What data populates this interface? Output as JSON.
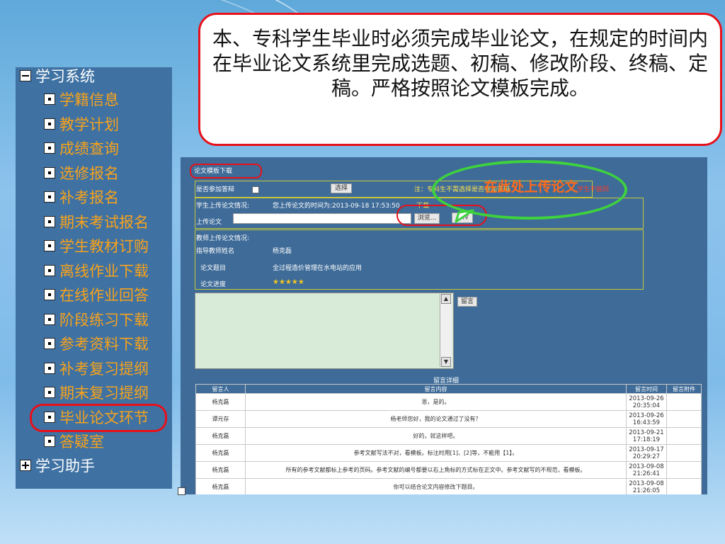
{
  "callout": {
    "text": "本、专科学生毕业时必须完成毕业论文，在规定的时间内在毕业论文系统里完成选题、初稿、修改阶段、终稿、定稿。严格按照论文模板完成。"
  },
  "sidebar": {
    "root": "学习系统",
    "items": [
      "学籍信息",
      "教学计划",
      "成绩查询",
      "选修报名",
      "补考报名",
      "期末考试报名",
      "学生教材订购",
      "离线作业下载",
      "在线作业回答",
      "阶段练习下载",
      "参考资料下载",
      "补考复习提纲",
      "期末复习提纲",
      "毕业论文环节",
      "答疑室"
    ],
    "root2": "学习助手"
  },
  "panel": {
    "template_link": "论文模板下载",
    "participate_label": "是否参加答辩",
    "select_button": "选择",
    "note": "注：专科生不需选择是否参加答辩",
    "note_tail": "学生不能同",
    "student_upload_label": "学生上传论文情况:",
    "upload_time": "您上传论文的时间为:2013-09-18  17:53:50",
    "upload_time_tail": "下载",
    "upload_label": "上传论文",
    "browse_button": "浏览...",
    "upload_button": "上传",
    "teacher_upload_label": "教师上传论文情况:",
    "advisor_label": "指导教师姓名",
    "advisor_name": "杨克磊",
    "topic_label": "论文题目",
    "topic": "全过程造价管理在水电站的应用",
    "progress_label": "论文进度",
    "progress_stars": 5,
    "message_button": "留言",
    "detail_title": "留言详细"
  },
  "messages": {
    "columns": [
      "留言人",
      "留言内容",
      "留言时间",
      "留言附件"
    ],
    "rows": [
      {
        "author": "杨克磊",
        "content": "恩，是的。",
        "date": "2013-09-26",
        "time": "20:35:04"
      },
      {
        "author": "谭元存",
        "content": "杨老师您好，我的论文通过了没有？",
        "date": "2013-09-26",
        "time": "16:43:59"
      },
      {
        "author": "杨克磊",
        "content": "好的，就这样吧。",
        "date": "2013-09-21",
        "time": "17:18:19"
      },
      {
        "author": "杨克磊",
        "content": "参考文献写法不对，看模板。标注时用[1]、[2]等，不能用【1】。",
        "date": "2013-09-17",
        "time": "20:29:27"
      },
      {
        "author": "杨克磊",
        "content": "所有的参考文献都标上参考的页码。参考文献的编号都要以右上角标的方式标在正文中。参考文献写的不规范，看模板。",
        "date": "2013-09-08",
        "time": "21:26:41"
      },
      {
        "author": "杨克磊",
        "content": "你可以结合论文内容修改下题目。",
        "date": "2013-09-08",
        "time": "21:26:05"
      }
    ]
  },
  "annotation": {
    "green_text": "在此处上传论文"
  },
  "colors": {
    "sidebar_bg": "#3f72a3",
    "sidebar_link": "#f7a21c",
    "highlight_red": "#e8101a",
    "highlight_green": "#3ed23e",
    "annotation_text": "#ff6a1a"
  }
}
